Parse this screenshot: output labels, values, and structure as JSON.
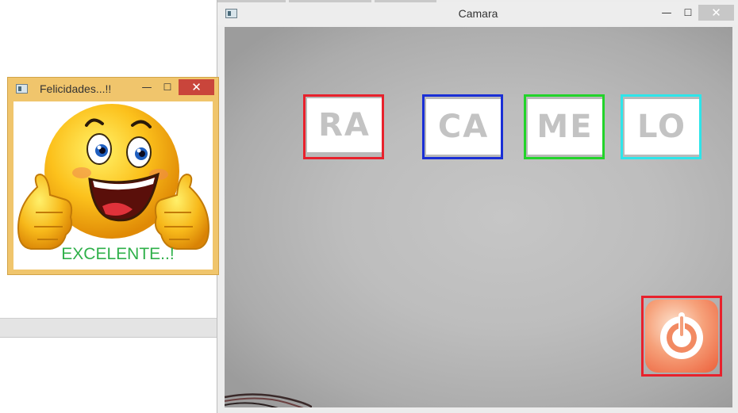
{
  "camera_window": {
    "title": "Camara",
    "buttons": {
      "minimize": "—",
      "maximize": "☐",
      "close": "✕"
    },
    "syllables": [
      "RA",
      "CA",
      "ME",
      "LO"
    ],
    "syllable_box_colors": [
      "#e8212c",
      "#1a2fd6",
      "#22d42a",
      "#2ee5ea"
    ],
    "power_icon": "power-icon",
    "power_box_color": "#e8212c"
  },
  "congrats_window": {
    "title": "Felicidades...!!",
    "buttons": {
      "minimize": "—",
      "maximize": "☐",
      "close": "✕"
    },
    "image": "thumbs-up-smiley",
    "message": "EXCELENTE..!",
    "message_color": "#2fb04a"
  }
}
